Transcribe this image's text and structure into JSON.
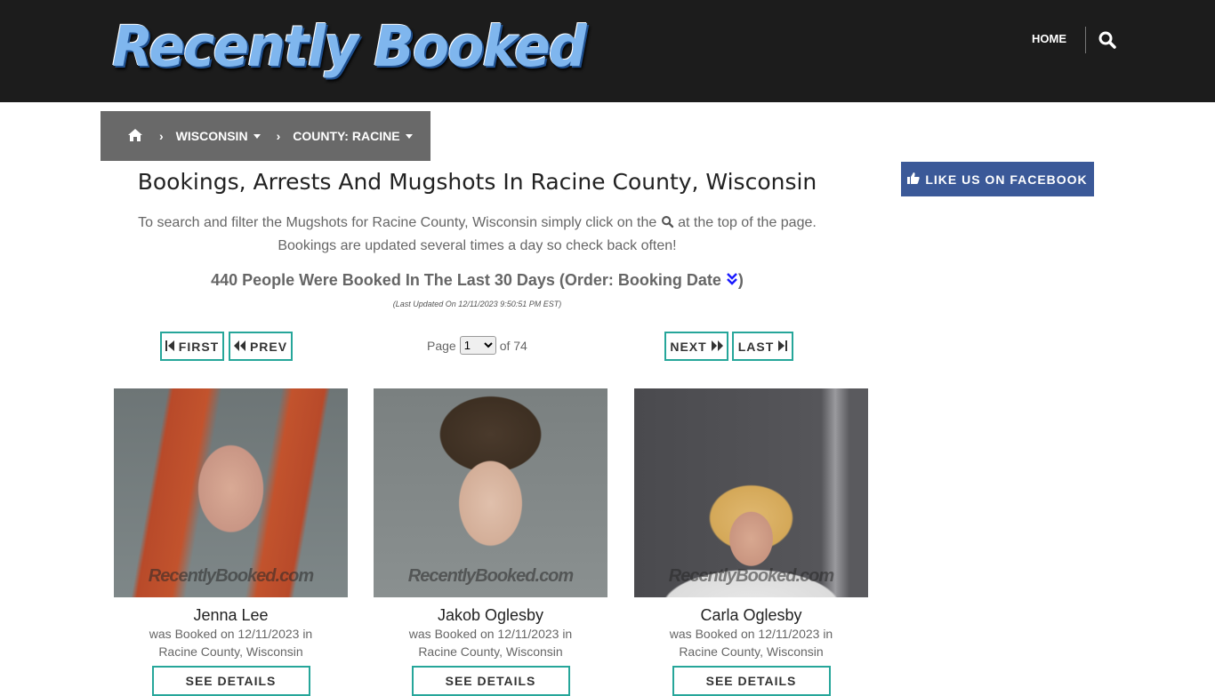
{
  "header": {
    "logo_text": "Recently Booked",
    "nav_home": "HOME"
  },
  "breadcrumb": {
    "state": "WISCONSIN",
    "county": "COUNTY: RACINE"
  },
  "main": {
    "title": "Bookings, Arrests And Mugshots In Racine County, Wisconsin",
    "desc_line1_a": "To search and filter the Mugshots for Racine County, Wisconsin simply click on the",
    "desc_line1_b": "at the top of the page.",
    "desc_line2": "Bookings are updated several times a day so check back often!",
    "count_text": "440 People Were Booked In The Last 30 Days (Order: Booking Date",
    "count_close": ")",
    "updated": "(Last Updated On 12/11/2023 9:50:51 PM EST)"
  },
  "pagination": {
    "first": "FIRST",
    "prev": "PREV",
    "next": "NEXT",
    "last": "LAST",
    "page_label": "Page",
    "page_value": "1",
    "of_label": "of 74"
  },
  "facebook": {
    "label": "LIKE US ON FACEBOOK"
  },
  "watermark": "RecentlyBooked.com",
  "cards": [
    {
      "name": "Jenna Lee",
      "line1": "was Booked on 12/11/2023 in",
      "line2": "Racine County, Wisconsin",
      "button": "SEE DETAILS"
    },
    {
      "name": "Jakob Oglesby",
      "line1": "was Booked on 12/11/2023 in",
      "line2": "Racine County, Wisconsin",
      "button": "SEE DETAILS"
    },
    {
      "name": "Carla Oglesby",
      "line1": "was Booked on 12/11/2023 in",
      "line2": "Racine County, Wisconsin",
      "button": "SEE DETAILS"
    }
  ],
  "colors": {
    "accent": "#26a69a",
    "facebook": "#3b5998",
    "header_bg": "#1c1c1c",
    "breadcrumb_bg": "#696969"
  }
}
